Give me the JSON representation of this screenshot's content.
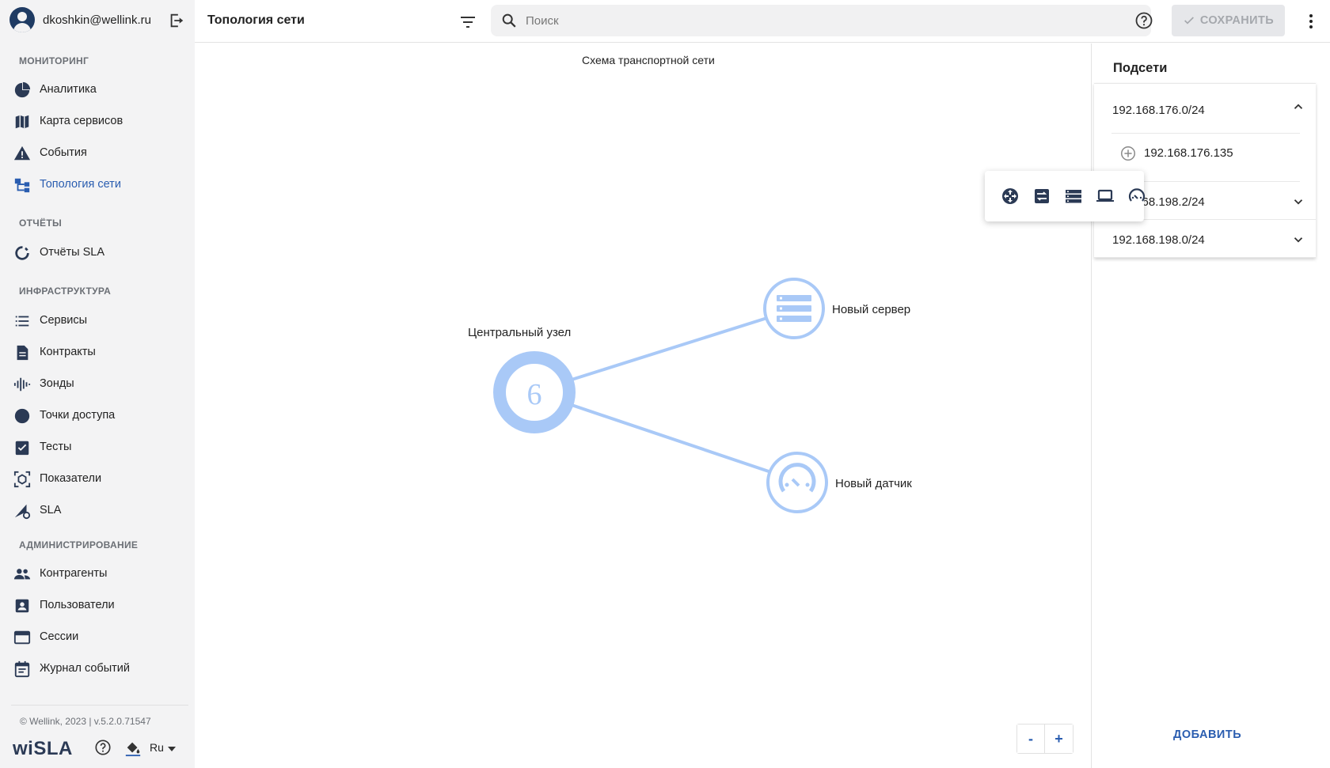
{
  "user": {
    "email": "dkoshkin@wellink.ru"
  },
  "sidebar": {
    "sections": [
      {
        "title": "МОНИТОРИНГ"
      },
      {
        "title": "ОТЧЁТЫ"
      },
      {
        "title": "ИНФРАСТРУКТУРА"
      },
      {
        "title": "АДМИНИСТРИРОВАНИЕ"
      }
    ],
    "items": [
      {
        "label": "Аналитика",
        "icon": "pie-chart-icon"
      },
      {
        "label": "Карта сервисов",
        "icon": "map-icon"
      },
      {
        "label": "События",
        "icon": "warning-icon"
      },
      {
        "label": "Топология сети",
        "icon": "topology-icon",
        "active": true
      },
      {
        "label": "Отчёты SLA",
        "icon": "donut-icon"
      },
      {
        "label": "Сервисы",
        "icon": "list-icon"
      },
      {
        "label": "Контракты",
        "icon": "document-icon"
      },
      {
        "label": "Зонды",
        "icon": "signal-icon"
      },
      {
        "label": "Точки доступа",
        "icon": "circle-icon"
      },
      {
        "label": "Тесты",
        "icon": "clipboard-check-icon"
      },
      {
        "label": "Показатели",
        "icon": "metrics-icon"
      },
      {
        "label": "SLA",
        "icon": "sla-icon"
      },
      {
        "label": "Контрагенты",
        "icon": "people-icon"
      },
      {
        "label": "Пользователи",
        "icon": "user-badge-icon"
      },
      {
        "label": "Сессии",
        "icon": "window-icon"
      },
      {
        "label": "Журнал событий",
        "icon": "calendar-icon"
      }
    ],
    "copyright": "© Wellink, 2023 | v.5.2.0.71547",
    "logo": "wiSLA",
    "language": "Ru"
  },
  "header": {
    "title": "Топология сети",
    "search_placeholder": "Поиск",
    "save_label": "СОХРАНИТЬ"
  },
  "canvas": {
    "title": "Схема транспортной сети",
    "central_node": {
      "label": "Центральный узел",
      "count": "6"
    },
    "nodes": [
      {
        "label": "Новый сервер",
        "icon": "server-icon"
      },
      {
        "label": "Новый датчик",
        "icon": "gauge-icon"
      }
    ],
    "zoom_out": "-",
    "zoom_in": "+",
    "accent_color": "#a9c9f7"
  },
  "toolbar": {
    "tools": [
      {
        "icon": "hub-icon"
      },
      {
        "icon": "switch-icon"
      },
      {
        "icon": "server-icon"
      },
      {
        "icon": "laptop-icon"
      },
      {
        "icon": "gauge-icon"
      }
    ]
  },
  "subnets": {
    "title": "Подсети",
    "items": [
      {
        "name": "192.168.176.0/24",
        "expanded": true,
        "children": [
          "192.168.176.135"
        ]
      },
      {
        "name": "192.168.198.2/24",
        "expanded": false
      },
      {
        "name": "192.168.198.0/24",
        "expanded": false
      }
    ],
    "add_label": "ДОБАВИТЬ"
  },
  "colors": {
    "primary": "#2a5db0",
    "sidebar_bg": "#f3f3f4",
    "node_blue": "#a9c9f7"
  }
}
